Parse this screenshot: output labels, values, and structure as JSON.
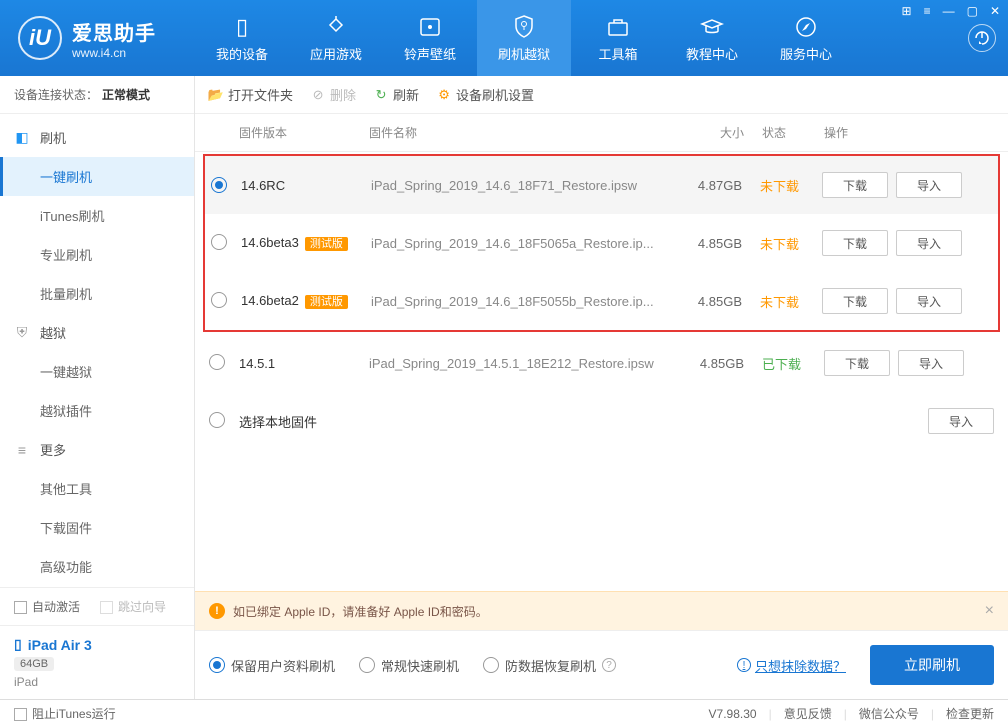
{
  "app": {
    "title": "爱思助手",
    "url": "www.i4.cn"
  },
  "nav": [
    {
      "label": "我的设备"
    },
    {
      "label": "应用游戏"
    },
    {
      "label": "铃声壁纸"
    },
    {
      "label": "刷机越狱"
    },
    {
      "label": "工具箱"
    },
    {
      "label": "教程中心"
    },
    {
      "label": "服务中心"
    }
  ],
  "status": {
    "label": "设备连接状态：",
    "mode": "正常模式"
  },
  "sidebar": {
    "groups": [
      {
        "label": "刷机",
        "items": [
          "一键刷机",
          "iTunes刷机",
          "专业刷机",
          "批量刷机"
        ]
      },
      {
        "label": "越狱",
        "items": [
          "一键越狱",
          "越狱插件"
        ]
      },
      {
        "label": "更多",
        "items": [
          "其他工具",
          "下载固件",
          "高级功能"
        ]
      }
    ],
    "checks": {
      "auto": "自动激活",
      "skip": "跳过向导"
    }
  },
  "device": {
    "name": "iPad Air 3",
    "storage": "64GB",
    "type": "iPad"
  },
  "toolbar": {
    "open": "打开文件夹",
    "delete": "删除",
    "refresh": "刷新",
    "settings": "设备刷机设置"
  },
  "table": {
    "headers": {
      "ver": "固件版本",
      "name": "固件名称",
      "size": "大小",
      "status": "状态",
      "act": "操作"
    },
    "rows": [
      {
        "ver": "14.6RC",
        "beta": false,
        "name": "iPad_Spring_2019_14.6_18F71_Restore.ipsw",
        "size": "4.87GB",
        "status": "未下载",
        "statusClass": "undl",
        "selected": true
      },
      {
        "ver": "14.6beta3",
        "beta": true,
        "name": "iPad_Spring_2019_14.6_18F5065a_Restore.ip...",
        "size": "4.85GB",
        "status": "未下载",
        "statusClass": "undl",
        "selected": false
      },
      {
        "ver": "14.6beta2",
        "beta": true,
        "name": "iPad_Spring_2019_14.6_18F5055b_Restore.ip...",
        "size": "4.85GB",
        "status": "未下载",
        "statusClass": "undl",
        "selected": false
      }
    ],
    "extraRow": {
      "ver": "14.5.1",
      "name": "iPad_Spring_2019_14.5.1_18E212_Restore.ipsw",
      "size": "4.85GB",
      "status": "已下载",
      "statusClass": "dl"
    },
    "localRow": "选择本地固件",
    "betaBadge": "测试版",
    "btnDownload": "下载",
    "btnImport": "导入"
  },
  "warning": "如已绑定 Apple ID，请准备好 Apple ID和密码。",
  "options": {
    "opt1": "保留用户资料刷机",
    "opt2": "常规快速刷机",
    "opt3": "防数据恢复刷机",
    "erase": "只想抹除数据？",
    "flash": "立即刷机"
  },
  "footer": {
    "stopItunes": "阻止iTunes运行",
    "version": "V7.98.30",
    "feedback": "意见反馈",
    "wechat": "微信公众号",
    "update": "检查更新"
  }
}
